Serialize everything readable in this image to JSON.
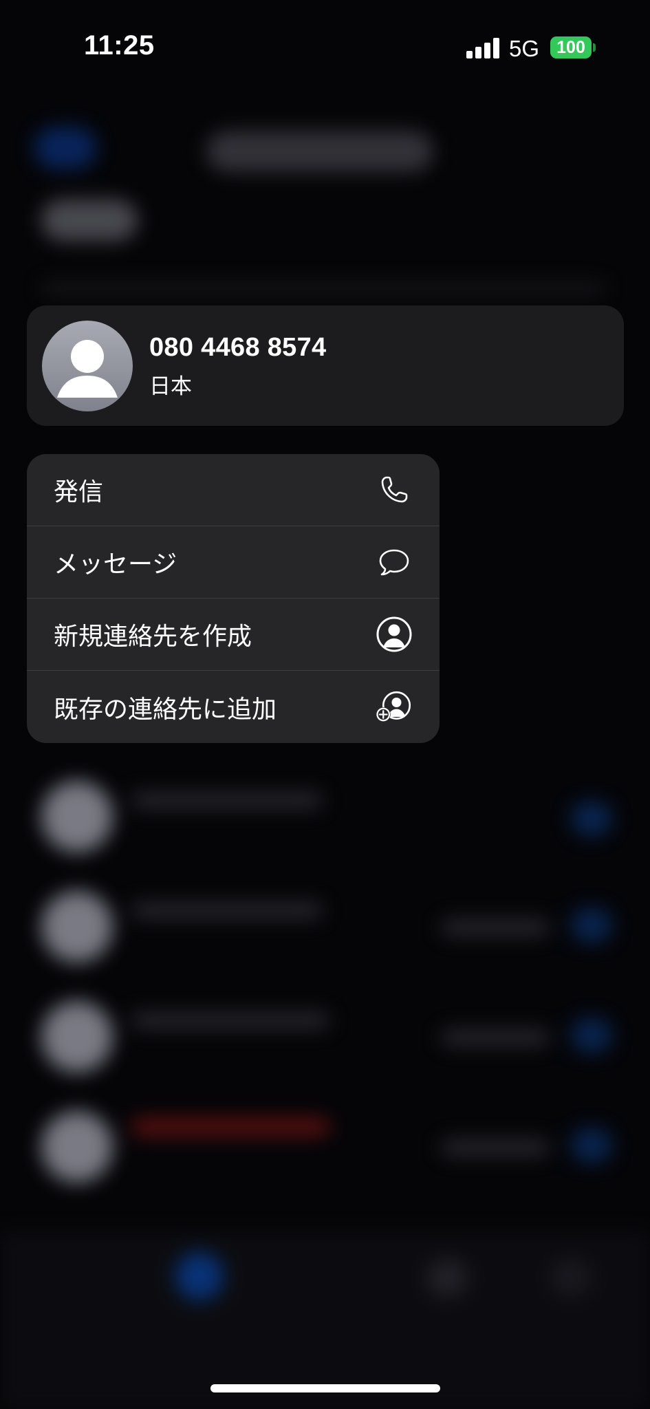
{
  "status_bar": {
    "time": "11:25",
    "network": "5G",
    "battery": "100",
    "battery_color": "#34c759"
  },
  "contact": {
    "number": "080 4468 8574",
    "region": "日本",
    "avatar_icon": "person-silhouette-icon"
  },
  "menu": {
    "items": [
      {
        "label": "発信",
        "icon": "phone-icon"
      },
      {
        "label": "メッセージ",
        "icon": "message-bubble-icon"
      },
      {
        "label": "新規連絡先を作成",
        "icon": "person-circle-icon"
      },
      {
        "label": "既存の連絡先に追加",
        "icon": "person-add-icon"
      }
    ]
  },
  "colors": {
    "background": "#050508",
    "card": "#1c1c1e",
    "menu": "#262628",
    "accent_blue": "#0a84ff"
  }
}
